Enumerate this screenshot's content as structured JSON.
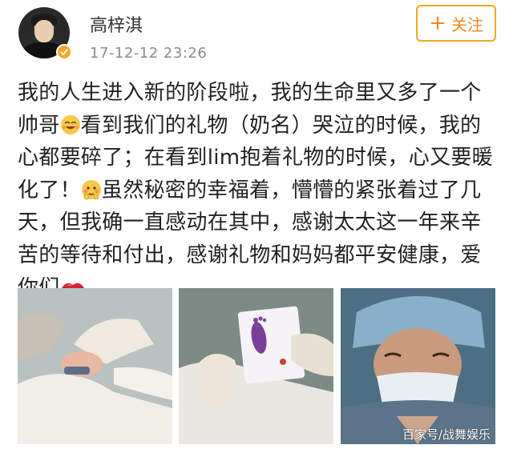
{
  "post": {
    "username": "高梓淇",
    "timestamp": "17-12-12 23:26",
    "follow_label": "关注",
    "text_lines": [
      "我的人生进入新的阶段啦，我的生命里又多了一个",
      [
        "帅哥",
        "看到我们的礼物（奶名）哭泣的时候，我的"
      ],
      "心都要碎了；在看到lim抱着礼物的时候，心又要暖",
      [
        "化了！",
        "虽然秘密的幸福着，懵懵的紧张着过了几"
      ],
      "天，但我确一直感动在其中，感谢太太这一年来辛",
      "苦的等待和付出，感谢礼物和妈妈都平安健康，爱",
      "你们"
    ]
  },
  "photos": {
    "watermark": "百家号/战舞娱乐"
  },
  "colors": {
    "accent": "#f5a623",
    "follow_text": "#f08a24",
    "timestamp": "#8a8a8a"
  },
  "icons": [
    "verified-badge-icon",
    "plus-icon",
    "smile-emoji-icon",
    "shy-emoji-icon",
    "kiss-lips-icon"
  ]
}
